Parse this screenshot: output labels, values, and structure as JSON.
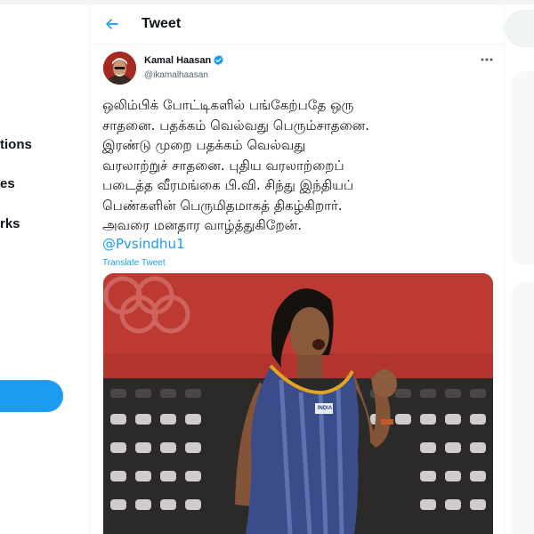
{
  "nav": {
    "items": [
      {
        "label": "tions"
      },
      {
        "label": "es"
      },
      {
        "label": "rks"
      }
    ]
  },
  "header": {
    "title": "Tweet"
  },
  "tweet": {
    "author": {
      "display_name": "Kamal Haasan",
      "handle": "@ikamalhaasan",
      "verified": true
    },
    "text_lines": [
      "ஒலிம்பிக் போட்டிகளில் பங்கேற்பதே ஒரு",
      "சாதனை. பதக்கம் வெல்வது பெரும்சாதனை.",
      "இரண்டு முறை பதக்கம் வெல்வது",
      "வரலாற்றுச் சாதனை. புதிய வரலாற்றைப்",
      "படைத்த வீரமங்கை பி.வி. சிந்து இந்தியப்",
      "பெண்களின் பெருமிதமாகத் திகழ்கிறார்.",
      "அவரை மனதார வாழ்த்துகிறேன்."
    ],
    "mention": "@Pvsindhu1",
    "translate_label": "Translate Tweet",
    "media": {
      "jersey_text": "INDIA"
    }
  },
  "colors": {
    "accent": "#1d9bf0",
    "text": "#0f1419",
    "secondary_text": "#536471",
    "media_bg": "#b2342f"
  },
  "icons": {
    "back": "arrow-left-icon",
    "verified": "verified-badge-icon",
    "more": "more-horizontal-icon"
  }
}
